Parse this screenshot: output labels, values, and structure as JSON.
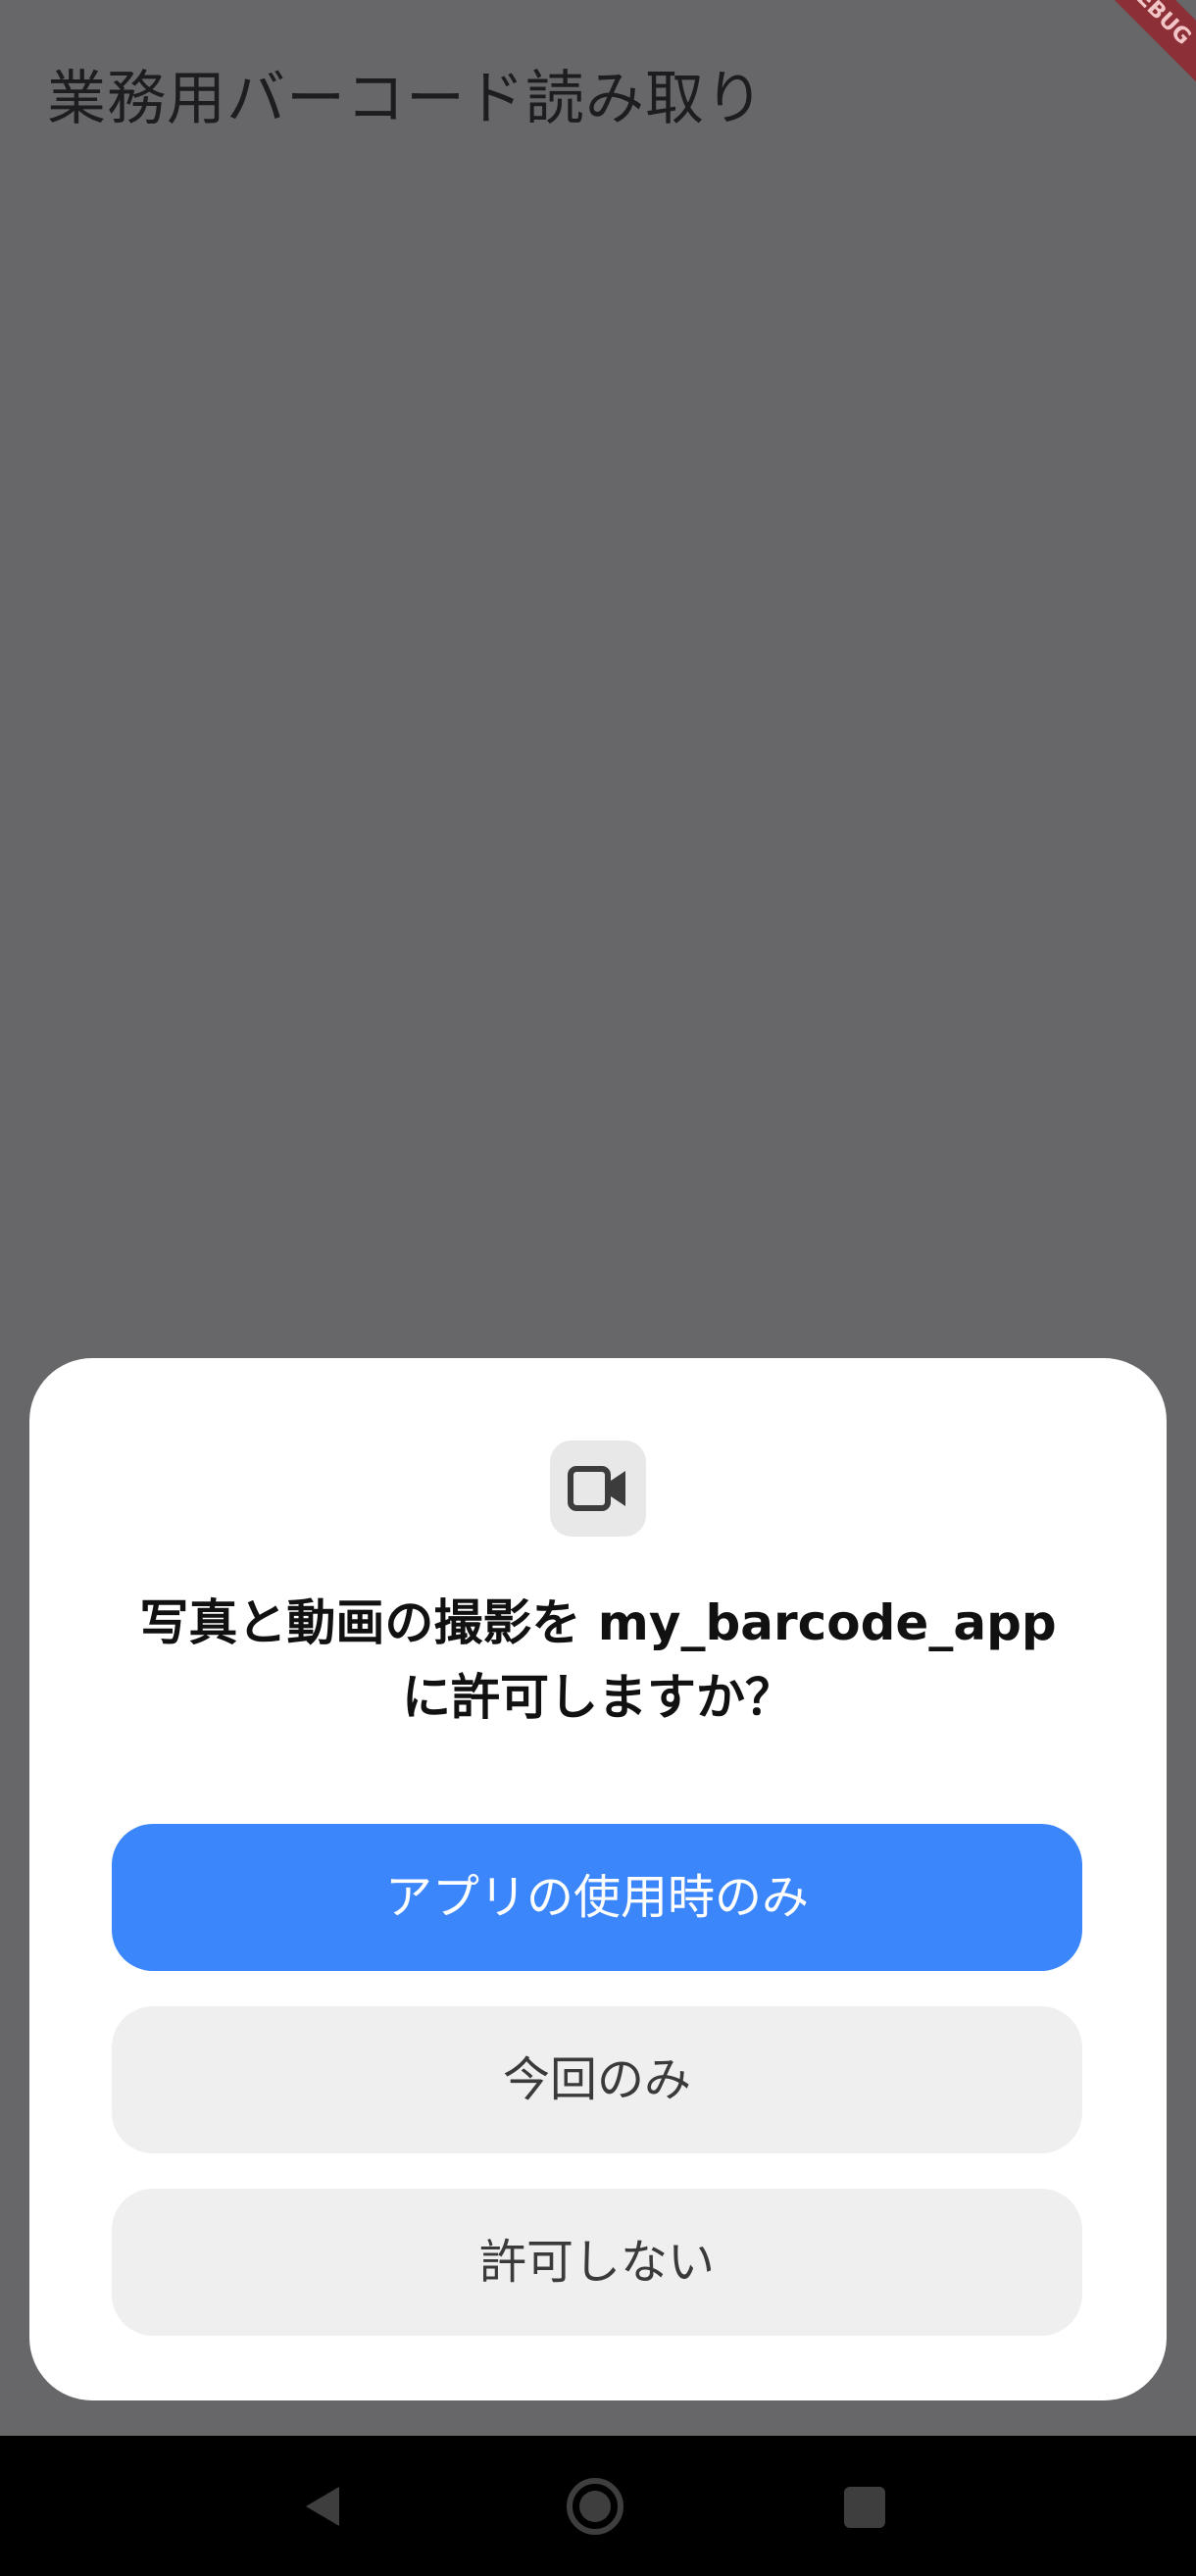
{
  "app_bar": {
    "title": "業務用バーコード読み取り",
    "debug_banner": "DEBUG"
  },
  "permission_dialog": {
    "icon": "video-camera-icon",
    "message_line1": "写真と動画の撮影を my_barcode_app",
    "message_line2": "に許可しますか？",
    "buttons": {
      "allow_while_using": "アプリの使用時のみ",
      "allow_once": "今回のみ",
      "deny": "許可しない"
    }
  },
  "navigation_bar": {
    "back": "back-triangle-icon",
    "home": "home-circle-icon",
    "recents": "recents-square-icon"
  },
  "colors": {
    "scrim": "#67676a",
    "dialog_background": "#ffffff",
    "primary_button": "#3b86fb",
    "secondary_button": "#efefef",
    "nav_bar": "#000000",
    "debug_banner": "#8c2f36"
  }
}
